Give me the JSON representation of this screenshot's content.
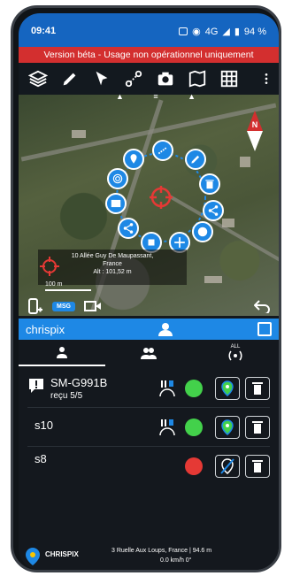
{
  "status_bar": {
    "time": "09:41",
    "network": "4G",
    "battery": "94 %"
  },
  "banner": {
    "text": "Version béta - Usage non opérationnel uniquement"
  },
  "map": {
    "address_line1": "10 Allée Guy De Maupassant,",
    "address_line2": "France",
    "altitude": "Alt : 101,52 m",
    "scale": "100 m",
    "compass_label": "N"
  },
  "user_bar": {
    "name": "chrispix"
  },
  "actionbar": {
    "msg_label": "MSG"
  },
  "tabs": {
    "all_label": "ALL"
  },
  "devices": [
    {
      "name": "SM-G991B",
      "status": "reçu 5/5",
      "dot_color": "#43d14b"
    },
    {
      "name": "s10",
      "status": "",
      "dot_color": "#43d14b"
    },
    {
      "name": "s8",
      "status": "",
      "dot_color": "#e53935"
    }
  ],
  "bottom": {
    "brand": "CHRISPIX",
    "address": "3 Ruelle Aux Loups, France | 94.6 m",
    "speed": "0.0 km/h 0°"
  },
  "colors": {
    "primary": "#1e88e5",
    "danger": "#d32f2f",
    "ok": "#43d14b"
  }
}
